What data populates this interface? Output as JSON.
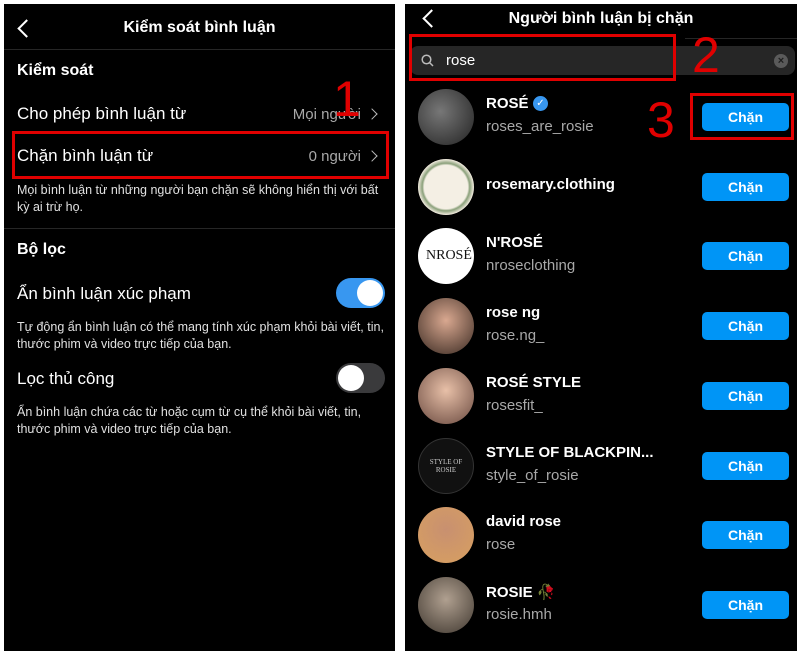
{
  "left": {
    "title": "Kiểm soát bình luận",
    "section_control": "Kiểm soát",
    "allow_from_label": "Cho phép bình luận từ",
    "allow_from_value": "Mọi người",
    "block_from_label": "Chặn bình luận từ",
    "block_from_value": "0 người",
    "block_desc": "Mọi bình luận từ những người bạn chặn sẽ không hiển thị với bất kỳ ai trừ họ.",
    "section_filter": "Bộ lọc",
    "hide_offensive_label": "Ẩn bình luận xúc phạm",
    "hide_offensive_on": true,
    "hide_offensive_desc": "Tự động ẩn bình luận có thể mang tính xúc phạm khỏi bài viết, tin, thước phim và video trực tiếp của bạn.",
    "manual_filter_label": "Lọc thủ công",
    "manual_filter_on": false,
    "manual_filter_desc": "Ẩn bình luận chứa các từ hoặc cụm từ cụ thể khỏi bài viết, tin, thước phim và video trực tiếp của bạn.",
    "annotation": "1"
  },
  "right": {
    "title": "Người bình luận bị chặn",
    "search_value": "rose",
    "annotation_search": "2",
    "annotation_button": "3",
    "block_label": "Chặn",
    "users": [
      {
        "name": "ROSÉ",
        "handle": "roses_are_rosie",
        "verified": true
      },
      {
        "name": "rosemary.clothing",
        "handle": ""
      },
      {
        "name": "N'ROSÉ",
        "handle": "nroseclothing",
        "avatar_text": "NROSÉ"
      },
      {
        "name": "rose ng",
        "handle": "rose.ng_"
      },
      {
        "name": "ROSÉ STYLE",
        "handle": "rosesfit_"
      },
      {
        "name": "STYLE OF BLACKPIN...",
        "handle": "style_of_rosie",
        "avatar_text": "STYLE OF ROSIE"
      },
      {
        "name": "david rose",
        "handle": "rose"
      },
      {
        "name": "ROSIE 🥀",
        "handle": "rosie.hmh"
      }
    ],
    "colors": {
      "accent": "#0095f6",
      "annotation": "#e00000"
    }
  }
}
